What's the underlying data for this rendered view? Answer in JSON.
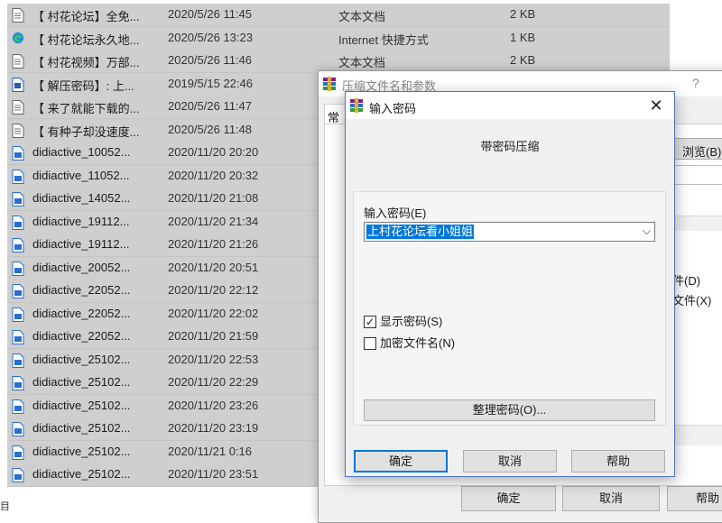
{
  "files": [
    {
      "name": "【 村花论坛】全免...",
      "date": "2020/5/26 11:45",
      "type": "文本文档",
      "size": "2 KB",
      "icon": "text-file-icon"
    },
    {
      "name": "【 村花论坛永久地...",
      "date": "2020/5/26 13:23",
      "type": "Internet 快捷方式",
      "size": "1 KB",
      "icon": "edge-shortcut-icon"
    },
    {
      "name": "【 村花视频】万部...",
      "date": "2020/5/26 11:46",
      "type": "文本文档",
      "size": "2 KB",
      "icon": "text-file-icon"
    },
    {
      "name": "【 解压密码】: 上...",
      "date": "2019/5/15 22:46",
      "type": "",
      "size": "",
      "icon": "document-file-icon"
    },
    {
      "name": "【 来了就能下载的...",
      "date": "2020/5/26 11:47",
      "type": "",
      "size": "",
      "icon": "text-file-icon"
    },
    {
      "name": "【 有种子却没速度...",
      "date": "2020/5/26 11:48",
      "type": "",
      "size": "",
      "icon": "text-file-icon"
    },
    {
      "name": "didiactive_10052...",
      "date": "2020/11/20 20:20",
      "type": "",
      "size": "",
      "icon": "media-file-icon"
    },
    {
      "name": "didiactive_11052...",
      "date": "2020/11/20 20:32",
      "type": "",
      "size": "",
      "icon": "media-file-icon"
    },
    {
      "name": "didiactive_14052...",
      "date": "2020/11/20 21:08",
      "type": "",
      "size": "",
      "icon": "media-file-icon"
    },
    {
      "name": "didiactive_19112...",
      "date": "2020/11/20 21:34",
      "type": "",
      "size": "",
      "icon": "media-file-icon"
    },
    {
      "name": "didiactive_19112...",
      "date": "2020/11/20 21:26",
      "type": "",
      "size": "",
      "icon": "media-file-icon"
    },
    {
      "name": "didiactive_20052...",
      "date": "2020/11/20 20:51",
      "type": "",
      "size": "",
      "icon": "media-file-icon"
    },
    {
      "name": "didiactive_22052...",
      "date": "2020/11/20 22:12",
      "type": "",
      "size": "",
      "icon": "media-file-icon"
    },
    {
      "name": "didiactive_22052...",
      "date": "2020/11/20 22:02",
      "type": "",
      "size": "",
      "icon": "media-file-icon"
    },
    {
      "name": "didiactive_22052...",
      "date": "2020/11/20 21:59",
      "type": "",
      "size": "",
      "icon": "media-file-icon"
    },
    {
      "name": "didiactive_25102...",
      "date": "2020/11/20 22:53",
      "type": "",
      "size": "",
      "icon": "media-file-icon"
    },
    {
      "name": "didiactive_25102...",
      "date": "2020/11/20 22:29",
      "type": "",
      "size": "",
      "icon": "media-file-icon"
    },
    {
      "name": "didiactive_25102...",
      "date": "2020/11/20 23:26",
      "type": "",
      "size": "",
      "icon": "media-file-icon"
    },
    {
      "name": "didiactive_25102...",
      "date": "2020/11/20 23:19",
      "type": "",
      "size": "",
      "icon": "media-file-icon"
    },
    {
      "name": "didiactive_25102...",
      "date": "2020/11/21 0:16",
      "type": "",
      "size": "",
      "icon": "media-file-icon"
    },
    {
      "name": "didiactive_25102...",
      "date": "2020/11/20 23:51",
      "type": "",
      "size": "",
      "icon": "media-file-icon"
    }
  ],
  "status_bar": {
    "icon": "目"
  },
  "bg_dialog": {
    "title": "压缩文件名和参数",
    "help": "?",
    "tab": "常",
    "browse": "浏览(B)",
    "option1": "件(D)",
    "option2": "文件(X)",
    "ok": "确定",
    "cancel": "取消",
    "help_button": "帮助"
  },
  "pw_dialog": {
    "title": "输入密码",
    "close": "✕",
    "heading": "带密码压缩",
    "field_label": "输入密码(E)",
    "password_value": "上村花论坛看小姐姐",
    "dropdown_glyph": "⌵",
    "show_password_label": "显示密码(S)",
    "show_password_checked": "✓",
    "encrypt_names_label": "加密文件名(N)",
    "encrypt_names_checked": "",
    "manage_button": "整理密码(O)...",
    "ok": "确定",
    "cancel": "取消",
    "help_button": "帮助"
  },
  "colors": {
    "selection": "#0078d7",
    "list_background": "#cfcfcf",
    "dialog_border": "#4a73c8"
  }
}
